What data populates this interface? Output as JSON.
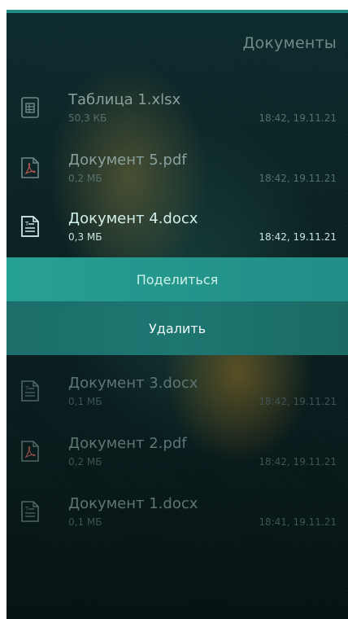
{
  "header": {
    "title": "Документы"
  },
  "files": [
    {
      "name": "Таблица 1.xlsx",
      "size": "50,3 КБ",
      "date": "18:42, 19.11.21",
      "icon": "spreadsheet-file-icon"
    },
    {
      "name": "Документ 5.pdf",
      "size": "0,2 МБ",
      "date": "18:42, 19.11.21",
      "icon": "pdf-file-icon"
    },
    {
      "name": "Документ 4.docx",
      "size": "0,3 МБ",
      "date": "18:42, 19.11.21",
      "icon": "text-document-icon"
    },
    {
      "name": "Документ 3.docx",
      "size": "0,1 МБ",
      "date": "18:42, 19.11.21",
      "icon": "text-document-icon"
    },
    {
      "name": "Документ 2.pdf",
      "size": "0,2 МБ",
      "date": "18:42, 19.11.21",
      "icon": "pdf-file-icon"
    },
    {
      "name": "Документ 1.docx",
      "size": "0,1 МБ",
      "date": "18:41, 19.11.21",
      "icon": "text-document-icon"
    }
  ],
  "actions": {
    "share_label": "Поделиться",
    "delete_label": "Удалить"
  },
  "colors": {
    "accent": "#26a093",
    "accent_dark": "#1c6e6a",
    "background": "#0a2022"
  }
}
